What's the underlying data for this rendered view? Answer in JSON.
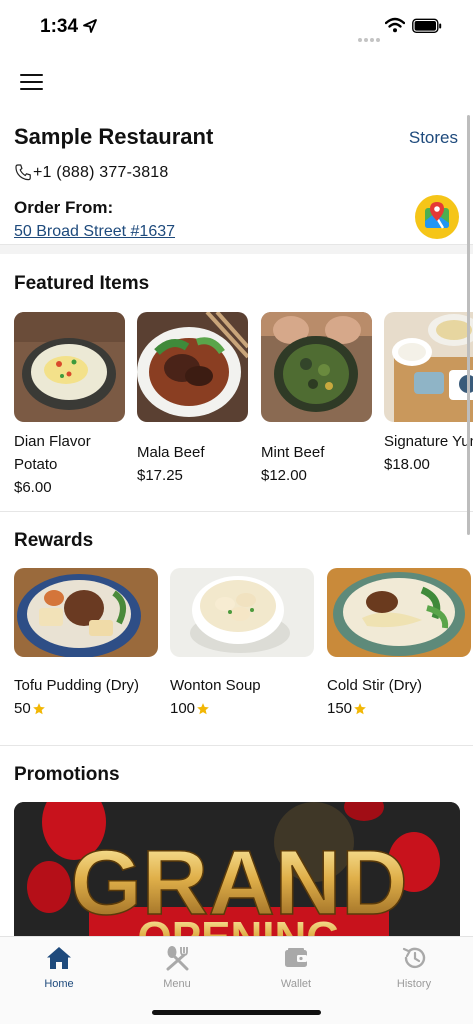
{
  "status_bar": {
    "time": "1:34"
  },
  "header": {
    "menu_icon": "hamburger-menu-icon"
  },
  "restaurant": {
    "name": "Sample Restaurant",
    "stores_label": "Stores",
    "phone": "+1 (888) 377-3818",
    "order_from_label": "Order From:",
    "address": "50 Broad Street #1637",
    "map_icon": "map-pin-icon"
  },
  "featured": {
    "title": "Featured Items",
    "items": [
      {
        "name": "Dian Flavor Potato",
        "price": "$6.00"
      },
      {
        "name": "Mala Beef",
        "price": "$17.25"
      },
      {
        "name": "Mint Beef",
        "price": "$12.00"
      },
      {
        "name": "Signature Yunnan Cros",
        "price": "$18.00"
      }
    ]
  },
  "rewards": {
    "title": "Rewards",
    "items": [
      {
        "name": "Tofu Pudding (Dry)",
        "points": "50"
      },
      {
        "name": "Wonton Soup",
        "points": "100"
      },
      {
        "name": "Cold Stir (Dry)",
        "points": "150"
      }
    ]
  },
  "promotions": {
    "title": "Promotions",
    "banner_text": "GRAND",
    "banner_subtext": "OPENING"
  },
  "tabs": [
    {
      "label": "Home",
      "icon": "home-icon",
      "active": true
    },
    {
      "label": "Menu",
      "icon": "utensils-icon",
      "active": false
    },
    {
      "label": "Wallet",
      "icon": "wallet-icon",
      "active": false
    },
    {
      "label": "History",
      "icon": "history-icon",
      "active": false
    }
  ],
  "colors": {
    "accent": "#1e4a7c",
    "star": "#f2b705",
    "map_button": "#f5c518"
  }
}
